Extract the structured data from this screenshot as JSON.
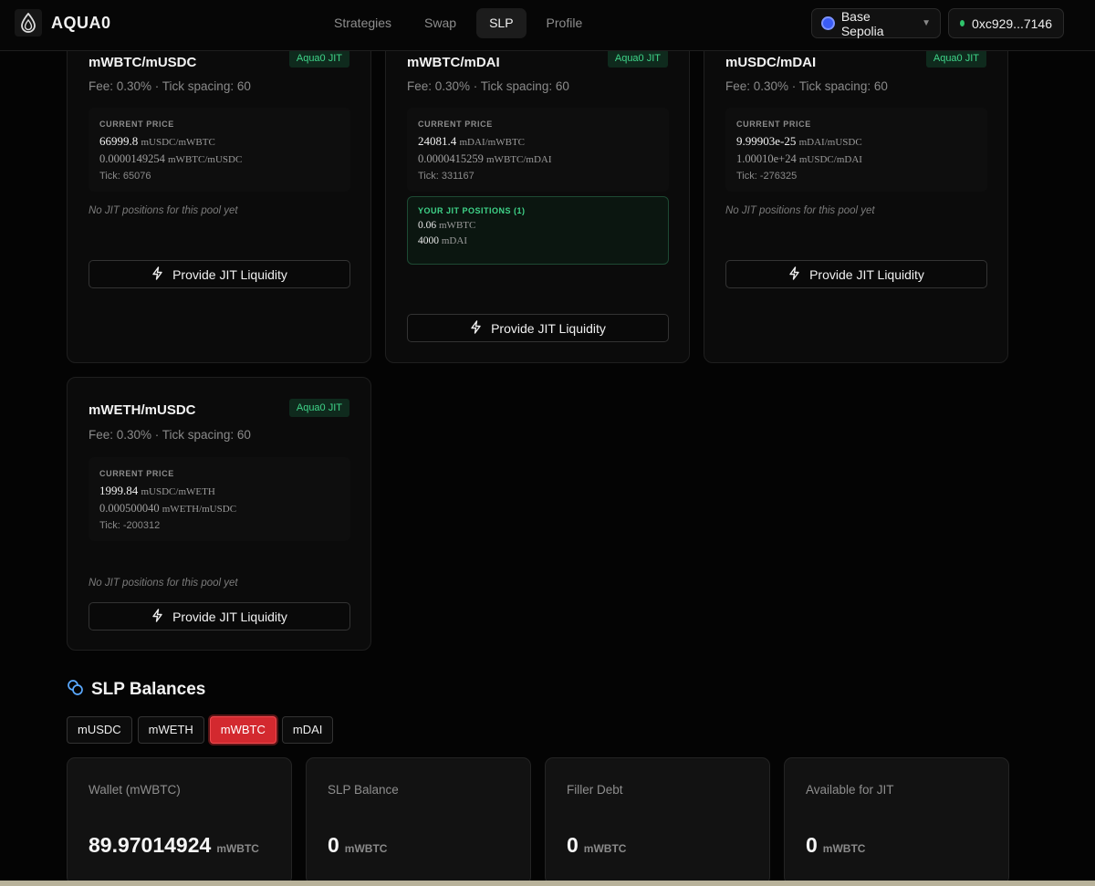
{
  "header": {
    "logo_text": "AQUA0",
    "nav": [
      "Strategies",
      "Swap",
      "SLP",
      "Profile"
    ],
    "active_nav": "SLP",
    "chain": "Base Sepolia",
    "wallet": "0xc929...7146"
  },
  "pools": [
    {
      "name": "mWBTC/mUSDC",
      "badge": "Aqua0 JIT",
      "fee": "Fee: 0.30% · Tick spacing: 60",
      "price_label": "CURRENT PRICE",
      "price_main": "66999.8",
      "price_main_unit": "mUSDC/mWBTC",
      "price_inv": "0.0000149254",
      "price_inv_unit": "mWBTC/mUSDC",
      "tick": "Tick: 65076",
      "no_jit": "No JIT positions for this pool yet",
      "button": "Provide JIT Liquidity"
    },
    {
      "name": "mWBTC/mDAI",
      "badge": "Aqua0 JIT",
      "fee": "Fee: 0.30% · Tick spacing: 60",
      "price_label": "CURRENT PRICE",
      "price_main": "24081.4",
      "price_main_unit": "mDAI/mWBTC",
      "price_inv": "0.0000415259",
      "price_inv_unit": "mWBTC/mDAI",
      "tick": "Tick: 331167",
      "positions_label": "YOUR JIT POSITIONS (1)",
      "positions": [
        {
          "amount": "0.06",
          "token": "mWBTC"
        },
        {
          "amount": "4000",
          "token": "mDAI"
        }
      ],
      "button": "Provide JIT Liquidity"
    },
    {
      "name": "mUSDC/mDAI",
      "badge": "Aqua0 JIT",
      "fee": "Fee: 0.30% · Tick spacing: 60",
      "price_label": "CURRENT PRICE",
      "price_main": "9.99903e-25",
      "price_main_unit": "mDAI/mUSDC",
      "price_inv": "1.00010e+24",
      "price_inv_unit": "mUSDC/mDAI",
      "tick": "Tick: -276325",
      "no_jit": "No JIT positions for this pool yet",
      "button": "Provide JIT Liquidity"
    },
    {
      "name": "mWETH/mUSDC",
      "badge": "Aqua0 JIT",
      "fee": "Fee: 0.30% · Tick spacing: 60",
      "price_label": "CURRENT PRICE",
      "price_main": "1999.84",
      "price_main_unit": "mUSDC/mWETH",
      "price_inv": "0.000500040",
      "price_inv_unit": "mWETH/mUSDC",
      "tick": "Tick: -200312",
      "no_jit": "No JIT positions for this pool yet",
      "button": "Provide JIT Liquidity"
    }
  ],
  "slp": {
    "title": "SLP Balances",
    "tabs": [
      "mUSDC",
      "mWETH",
      "mWBTC",
      "mDAI"
    ],
    "active_tab": "mWBTC",
    "stats": [
      {
        "label": "Wallet (mWBTC)",
        "value": "89.97014924",
        "unit": "mWBTC"
      },
      {
        "label": "SLP Balance",
        "value": "0",
        "unit": "mWBTC"
      },
      {
        "label": "Filler Debt",
        "value": "0",
        "unit": "mWBTC"
      },
      {
        "label": "Available for JIT",
        "value": "0",
        "unit": "mWBTC"
      }
    ]
  },
  "colors": {
    "accent_green": "#3fd489",
    "active_tab_red": "#d3292f",
    "chain_blue": "#3a5cf5",
    "status_green": "#2fc36b"
  },
  "icons": {
    "logo": "water-drop-icon",
    "chain": "base-chain-icon",
    "button": "lightning-icon",
    "slp": "coins-icon"
  }
}
